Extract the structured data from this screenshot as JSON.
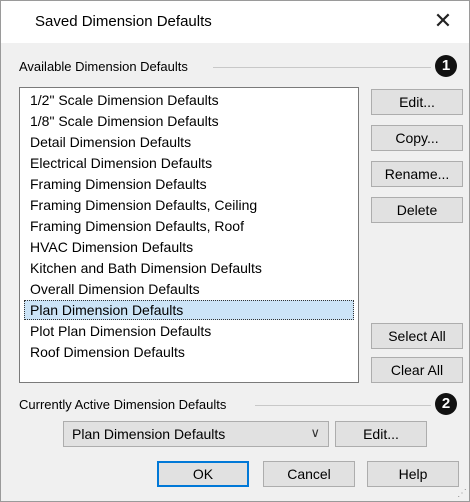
{
  "window": {
    "title": "Saved Dimension Defaults",
    "close_glyph": "✕"
  },
  "available": {
    "label": "Available Dimension Defaults",
    "badge": "1",
    "items": [
      "1/2\" Scale Dimension Defaults",
      "1/8\" Scale Dimension Defaults",
      "Detail Dimension Defaults",
      "Electrical Dimension Defaults",
      "Framing Dimension Defaults",
      "Framing Dimension Defaults, Ceiling",
      "Framing Dimension Defaults, Roof",
      "HVAC Dimension Defaults",
      "Kitchen and Bath Dimension Defaults",
      "Overall Dimension Defaults",
      "Plan Dimension Defaults",
      "Plot Plan Dimension Defaults",
      "Roof Dimension Defaults"
    ],
    "selected_item": "Plan Dimension Defaults"
  },
  "side_buttons": {
    "edit": "Edit...",
    "copy": "Copy...",
    "rename": "Rename...",
    "delete": "Delete",
    "select_all": "Select All",
    "clear_all": "Clear All"
  },
  "active": {
    "label": "Currently Active Dimension Defaults",
    "badge": "2",
    "selected": "Plan Dimension Defaults",
    "edit": "Edit..."
  },
  "footer": {
    "ok": "OK",
    "cancel": "Cancel",
    "help": "Help"
  },
  "colors": {
    "selection": "#cce4f7",
    "default_button_border": "#0078d7"
  },
  "icons": {
    "close": "close-icon",
    "dropdown": "chevron-down-icon",
    "resize": "resize-grip-icon"
  }
}
